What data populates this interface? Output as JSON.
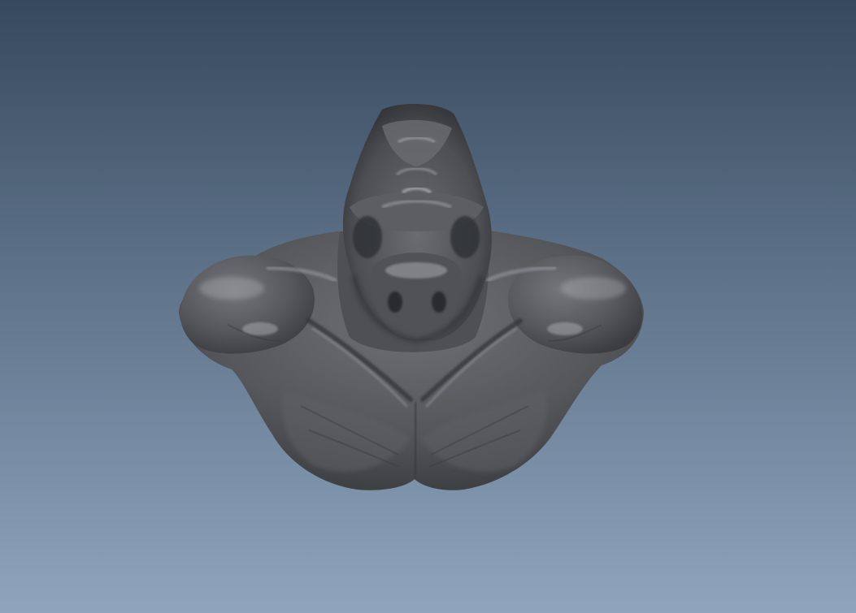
{
  "viewport": {
    "background_top_color": "#37495f",
    "background_bottom_color": "#8ea5bd",
    "mesh_color": "#5a5c60",
    "mesh_highlight_color": "#a9acb1",
    "mesh_shadow_color": "#2a2b2e"
  },
  "scene": {
    "object_icon": "sculpt-bust-mesh-icon"
  }
}
